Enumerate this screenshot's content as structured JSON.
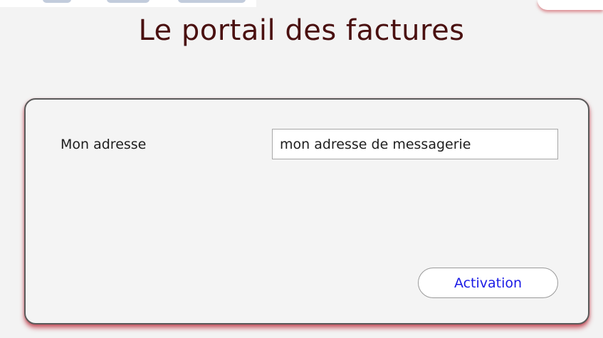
{
  "title": "Le portail des factures",
  "form": {
    "address_label": "Mon adresse",
    "address_value": "",
    "address_placeholder": "mon adresse de messagerie",
    "activation_label": "Activation"
  },
  "colors": {
    "title": "#4a1010",
    "button_text": "#1a1ae6",
    "panel_shadow": "#c0283a",
    "background": "#f3f3f3"
  }
}
